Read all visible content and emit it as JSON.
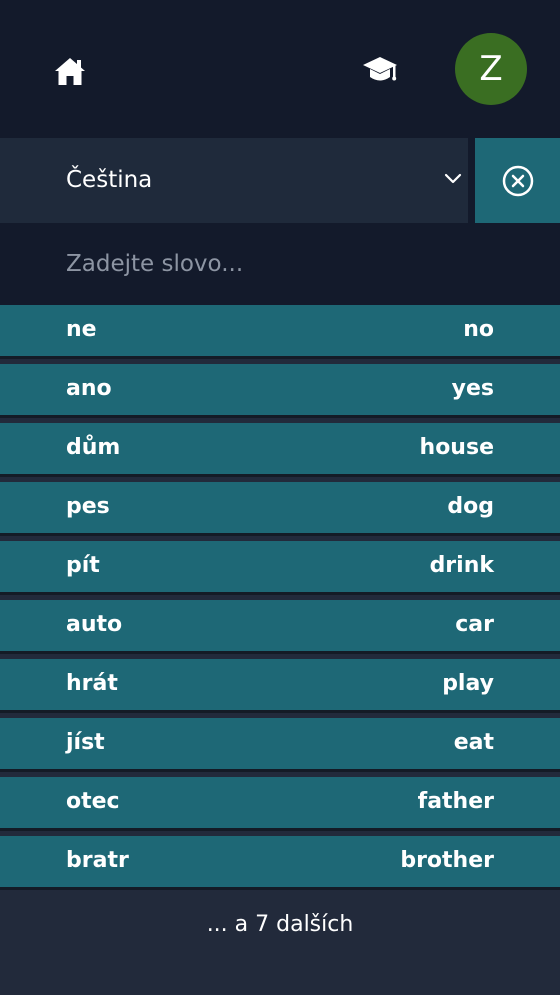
{
  "header": {
    "home_icon": "home-icon",
    "learn_icon": "graduation-cap-icon",
    "avatar_letter": "Z",
    "avatar_color": "#3a6e22"
  },
  "language": {
    "selected": "Čeština",
    "dropdown_icon": "chevron-down-icon",
    "clear_icon": "close-circle-icon"
  },
  "search": {
    "placeholder": "Zadejte slovo...",
    "value": ""
  },
  "words": [
    {
      "source": "ne",
      "target": "no"
    },
    {
      "source": "ano",
      "target": "yes"
    },
    {
      "source": "dům",
      "target": "house"
    },
    {
      "source": "pes",
      "target": "dog"
    },
    {
      "source": "pít",
      "target": "drink"
    },
    {
      "source": "auto",
      "target": "car"
    },
    {
      "source": "hrát",
      "target": "play"
    },
    {
      "source": "jíst",
      "target": "eat"
    },
    {
      "source": "otec",
      "target": "father"
    },
    {
      "source": "bratr",
      "target": "brother"
    }
  ],
  "more_label": "... a 7 dalších",
  "colors": {
    "header_bg": "#131a2b",
    "row_bg": "#1e6876",
    "page_bg": "#222a3b"
  }
}
